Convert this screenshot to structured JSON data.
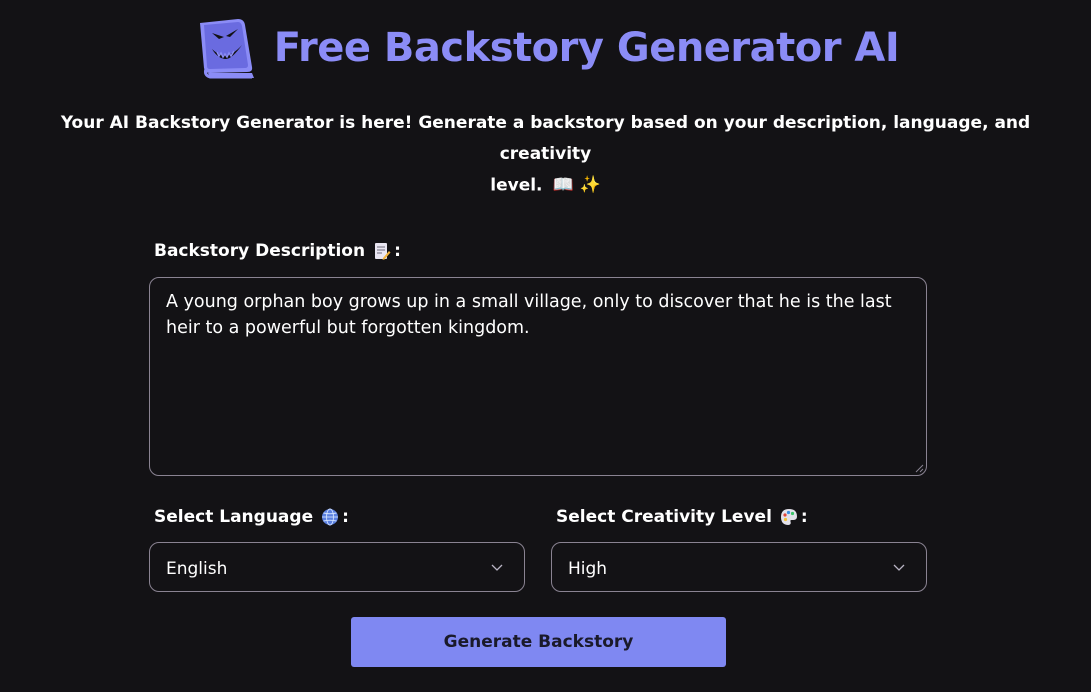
{
  "header": {
    "title": "Free Backstory Generator AI",
    "logo_icon": "monster-book-icon"
  },
  "subtitle": {
    "line1": "Your AI Backstory Generator is here! Generate a backstory based on your description, language, and creativity",
    "line2": "level.",
    "emojis": "📖 ✨"
  },
  "description": {
    "label": "Backstory Description",
    "label_icon": "memo-icon",
    "colon": ":",
    "value": "A young orphan boy grows up in a small village, only to discover that he is the last heir to a powerful but forgotten kingdom."
  },
  "language": {
    "label": "Select Language",
    "label_icon": "globe-icon",
    "colon": ":",
    "selected": "English"
  },
  "creativity": {
    "label": "Select Creativity Level",
    "label_icon": "palette-icon",
    "colon": ":",
    "selected": "High"
  },
  "actions": {
    "generate_label": "Generate Backstory"
  },
  "colors": {
    "accent": "#8b8cf6",
    "button": "#7f88f2",
    "background": "#131215",
    "border": "#8a8392"
  }
}
